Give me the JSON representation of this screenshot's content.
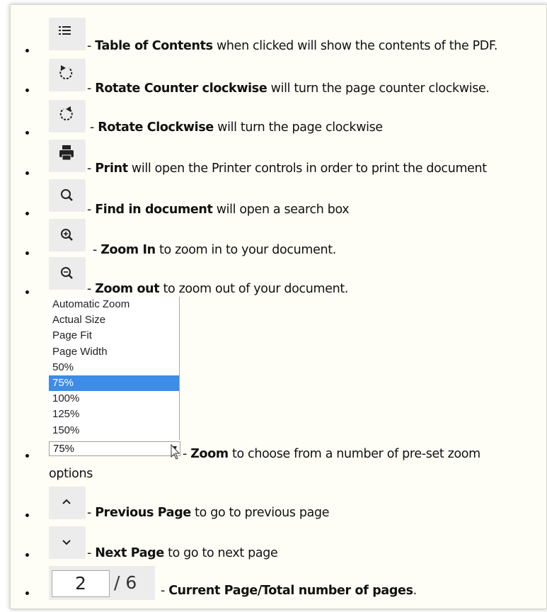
{
  "items": [
    {
      "icon": "table-of-contents-icon",
      "bold": "Table of Contents",
      "rest": " when clicked will show the contents of the PDF."
    },
    {
      "icon": "rotate-counterclockwise-icon",
      "bold": "Rotate Counter clockwise",
      "rest": " will turn the page counter clockwise."
    },
    {
      "icon": "rotate-clockwise-icon",
      "bold": "Rotate Clockwise",
      "rest": " will turn the page clockwise"
    },
    {
      "icon": "print-icon",
      "bold": "Print",
      "rest": " will open the Printer controls in order to print the document"
    },
    {
      "icon": "search-icon",
      "bold": "Find in document",
      "rest": " will open a search box"
    },
    {
      "icon": "zoom-in-icon",
      "bold": "Zoom In",
      "rest": " to zoom in to your document."
    },
    {
      "icon": "zoom-out-icon",
      "bold": "Zoom out",
      "rest": " to zoom out of your document."
    }
  ],
  "dash": "- ",
  "zoom": {
    "options": [
      "Automatic Zoom",
      "Actual Size",
      "Page Fit",
      "Page Width",
      "50%",
      "75%",
      "100%",
      "125%",
      "150%"
    ],
    "selected_index": 5,
    "selected_value": "75%",
    "bold": "Zoom",
    "rest": " to choose from a number of pre-set zoom",
    "rest_line2": "options"
  },
  "nav": [
    {
      "icon": "chevron-up-icon",
      "bold": "Previous Page",
      "rest": " to go to previous page"
    },
    {
      "icon": "chevron-down-icon",
      "bold": "Next Page",
      "rest": " to go to next page"
    }
  ],
  "page": {
    "current": "2",
    "total": "/ 6",
    "bold": "Current Page/Total number of pages",
    "rest": "."
  }
}
